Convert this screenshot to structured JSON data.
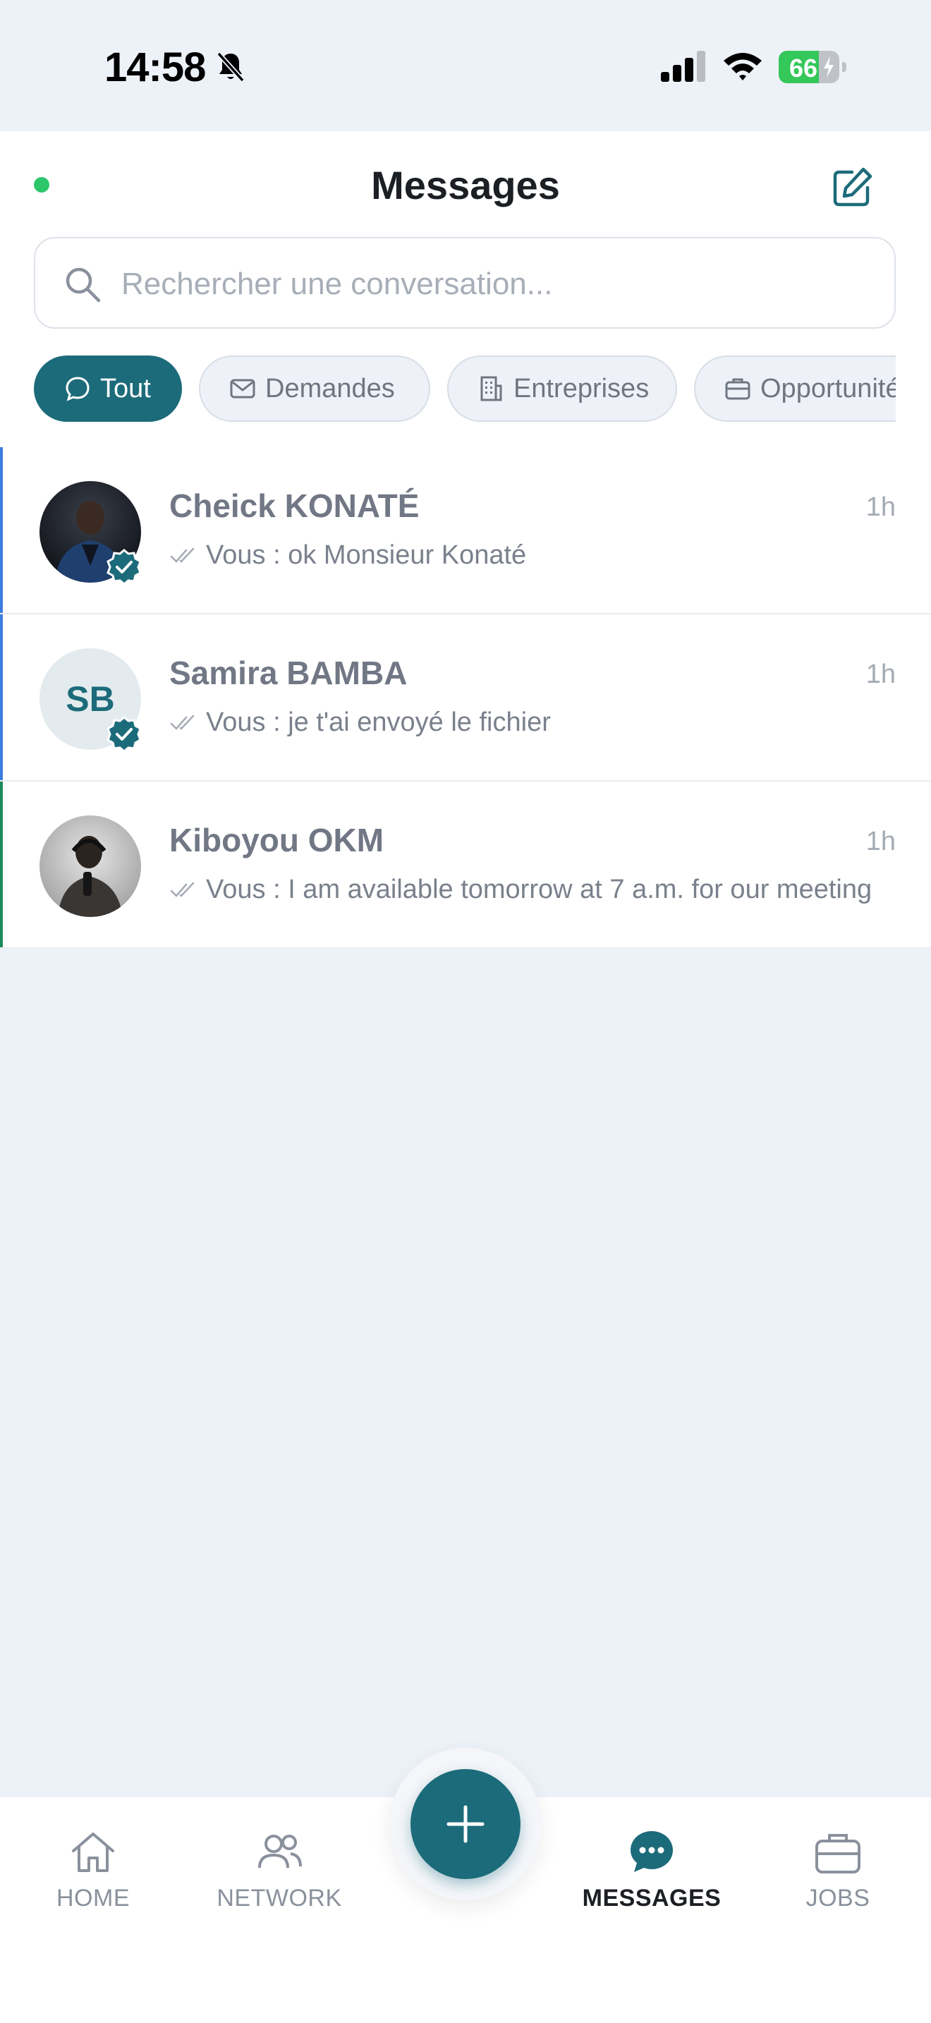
{
  "status_bar": {
    "time": "14:58",
    "battery_level": "66",
    "icons": [
      "bell-off-icon",
      "cellular-signal-icon",
      "wifi-icon",
      "battery-charging-icon"
    ]
  },
  "header": {
    "title": "Messages",
    "compose_icon": "compose-icon",
    "status_color": "#2DC66B"
  },
  "search": {
    "placeholder": "Rechercher une conversation..."
  },
  "filters": [
    {
      "label": "Tout",
      "icon": "chat-bubble-icon",
      "active": true
    },
    {
      "label": "Demandes",
      "icon": "envelope-icon",
      "active": false
    },
    {
      "label": "Entreprises",
      "icon": "building-icon",
      "active": false
    },
    {
      "label": "Opportunités",
      "icon": "briefcase-icon",
      "active": false
    }
  ],
  "conversations": [
    {
      "name": "Cheick KONATÉ",
      "time": "1h",
      "preview": "Vous : ok Monsieur Konaté",
      "verified": true,
      "avatar": "photo",
      "accent": "#3D7BE0"
    },
    {
      "name": "Samira BAMBA",
      "time": "1h",
      "initials": "SB",
      "preview": "Vous : je t'ai envoyé le fichier",
      "verified": true,
      "avatar": "initials",
      "accent": "#3D7BE0"
    },
    {
      "name": "Kiboyou OKM",
      "time": "1h",
      "preview": "Vous : I am available tomorrow at 7 a.m. for our meeting",
      "verified": false,
      "avatar": "photo",
      "accent": "#1C8A5A"
    }
  ],
  "bottom_nav": {
    "items": [
      {
        "label": "HOME",
        "icon": "home-icon",
        "active": false
      },
      {
        "label": "NETWORK",
        "icon": "people-icon",
        "active": false
      },
      {
        "label": "MESSAGES",
        "icon": "chat-dots-icon",
        "active": true
      },
      {
        "label": "JOBS",
        "icon": "briefcase-icon",
        "active": false
      }
    ],
    "fab_icon": "plus-icon"
  },
  "colors": {
    "brand": "#1C6B7A",
    "background": "#EDF1F8",
    "online": "#2DC66B",
    "battery": "#34C759"
  }
}
